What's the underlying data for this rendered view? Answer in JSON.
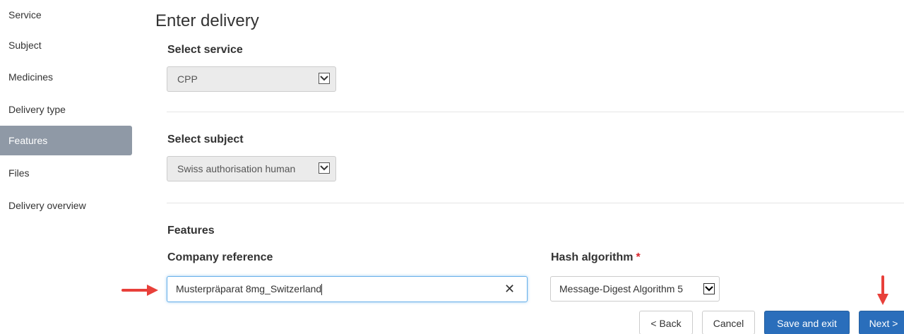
{
  "sidebar": {
    "items": [
      {
        "label": "Service"
      },
      {
        "label": "Subject"
      },
      {
        "label": "Medicines"
      },
      {
        "label": "Delivery type"
      },
      {
        "label": "Features",
        "active": true
      },
      {
        "label": "Files"
      },
      {
        "label": "Delivery overview"
      }
    ]
  },
  "main": {
    "title": "Enter delivery",
    "service": {
      "label": "Select service",
      "value": "CPP"
    },
    "subject": {
      "label": "Select subject",
      "value": "Swiss authorisation human"
    },
    "features": {
      "heading": "Features",
      "company_reference": {
        "label": "Company reference",
        "value": "Musterpräparat 8mg_Switzerland"
      },
      "hash_algorithm": {
        "label": "Hash algorithm",
        "required_mark": "*",
        "value": "Message-Digest Algorithm 5"
      }
    }
  },
  "buttons": {
    "back": "< Back",
    "cancel": "Cancel",
    "save_exit": "Save and exit",
    "next": "Next >"
  },
  "colors": {
    "accent": "#2a6ebb",
    "sidebar_active": "#8f99a6",
    "annotation_arrow": "#e8403a",
    "required": "#d9242b"
  },
  "icons": {
    "dropdown": "chevron-down-icon",
    "clear": "close-icon",
    "annotation": "red-arrow-icon"
  }
}
